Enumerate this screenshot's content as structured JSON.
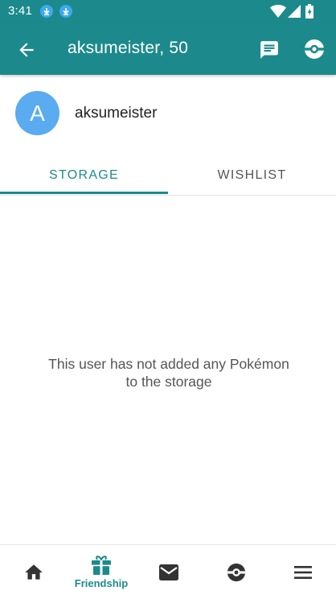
{
  "status_bar": {
    "time": "3:41"
  },
  "app_bar": {
    "title": "aksumeister, 50"
  },
  "profile": {
    "avatar_letter": "A",
    "username": "aksumeister",
    "avatar_color": "#5aabf0"
  },
  "tabs": [
    {
      "label": "STORAGE",
      "active": true
    },
    {
      "label": "WISHLIST",
      "active": false
    }
  ],
  "empty_message": {
    "line1": "This user has not added any Pokémon",
    "line2": "to the storage"
  },
  "bottom_nav": [
    {
      "icon": "home-icon",
      "label": ""
    },
    {
      "icon": "gift-icon",
      "label": "Friendship",
      "active": true
    },
    {
      "icon": "mail-icon",
      "label": ""
    },
    {
      "icon": "pokeball-icon",
      "label": ""
    },
    {
      "icon": "menu-icon",
      "label": ""
    }
  ],
  "colors": {
    "primary": "#1c8a8c",
    "avatar": "#5aabf0"
  }
}
